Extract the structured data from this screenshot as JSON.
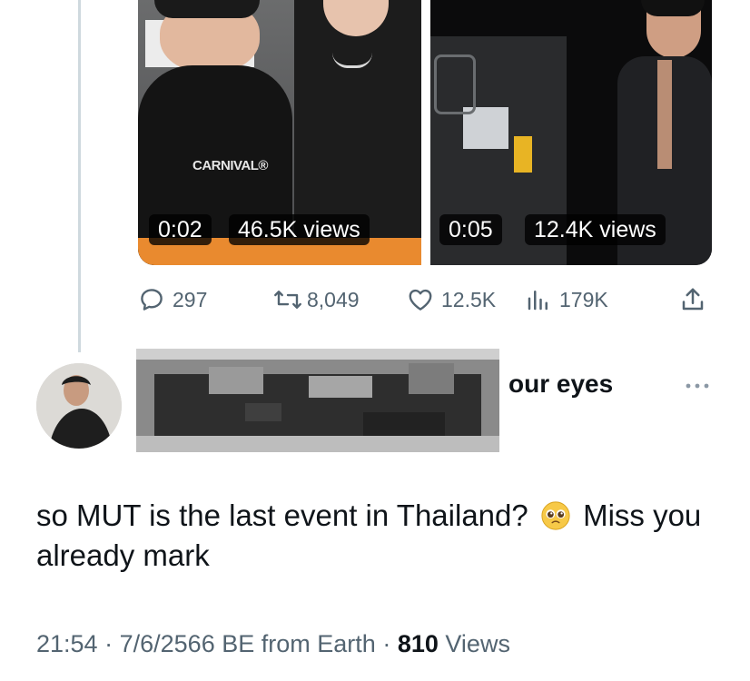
{
  "media": {
    "videos": [
      {
        "duration": "0:02",
        "views": "46.5K views",
        "shirt_text": "CARNIVAL®"
      },
      {
        "duration": "0:05",
        "views": "12.4K views"
      }
    ]
  },
  "engagement": {
    "replies": "297",
    "reposts": "8,049",
    "likes": "12.5K",
    "views": "179K"
  },
  "reply": {
    "handle_tail": "our eyes",
    "text_part1": "so MUT is the last event in Thailand?",
    "text_part2": "Miss you already mark",
    "emoji_icon": "pleading-face-icon",
    "time": "21:54",
    "date": "7/6/2566 BE",
    "source": "from Earth",
    "view_count": "810",
    "view_label": "Views",
    "separator": "·"
  },
  "colors": {
    "text_primary": "#0f1419",
    "text_secondary": "#536471",
    "thread_line": "#cfd9de"
  }
}
